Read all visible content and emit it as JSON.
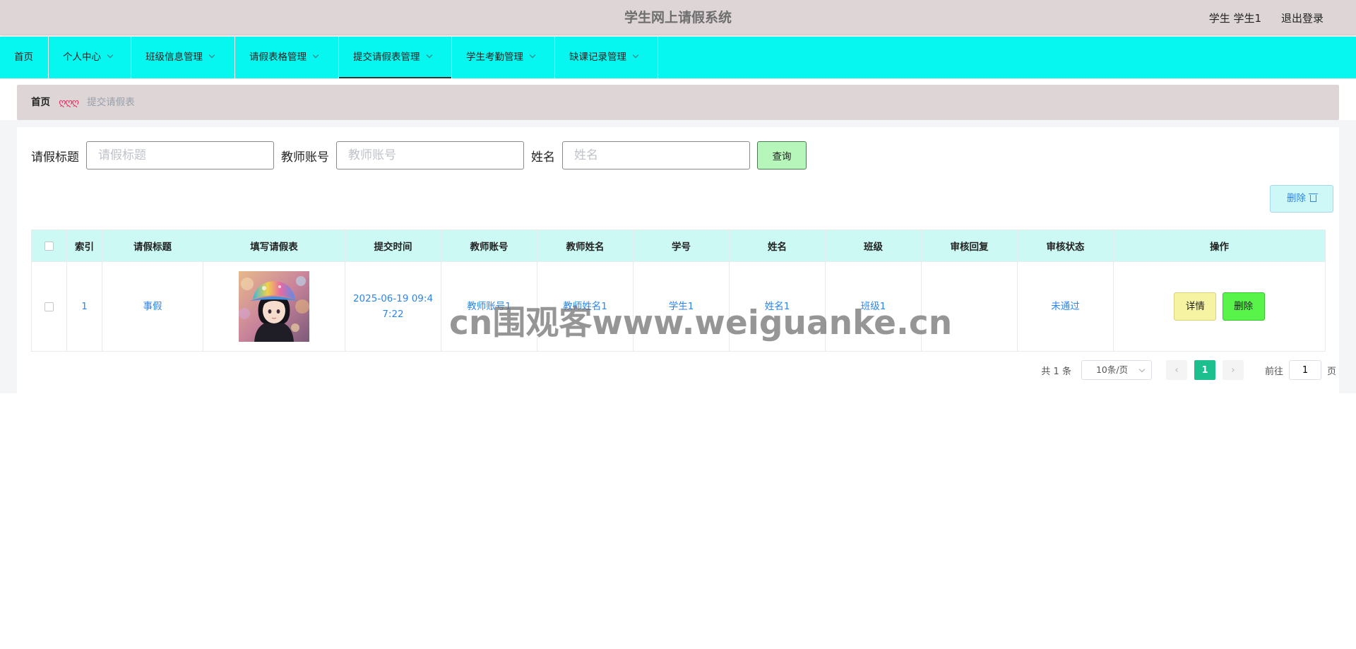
{
  "header": {
    "title": "学生网上请假系统",
    "user": "学生 学生1",
    "logout": "退出登录"
  },
  "nav": {
    "items": [
      {
        "label": "首页"
      },
      {
        "label": "个人中心"
      },
      {
        "label": "班级信息管理"
      },
      {
        "label": "请假表格管理"
      },
      {
        "label": "提交请假表管理"
      },
      {
        "label": "学生考勤管理"
      },
      {
        "label": "缺课记录管理"
      }
    ],
    "active": "提交请假表管理"
  },
  "breadcrumb": {
    "home": "首页",
    "separator": "ღღღ",
    "current": "提交请假表"
  },
  "search": {
    "fields": [
      {
        "label": "请假标题",
        "placeholder": "请假标题",
        "value": ""
      },
      {
        "label": "教师账号",
        "placeholder": "教师账号",
        "value": ""
      },
      {
        "label": "姓名",
        "placeholder": "姓名",
        "value": ""
      }
    ],
    "query_label": "查询"
  },
  "toolbar": {
    "delete_label": "删除"
  },
  "table": {
    "headers": [
      "索引",
      "请假标题",
      "填写请假表",
      "提交时间",
      "教师账号",
      "教师姓名",
      "学号",
      "姓名",
      "班级",
      "审核回复",
      "审核状态",
      "操作"
    ],
    "rows": [
      {
        "index": "1",
        "title": "事假",
        "image_icon": "avatar-image",
        "submit_time": "2025-06-19 09:47:22",
        "teacher_account": "教师账号1",
        "teacher_name": "教师姓名1",
        "student_id": "学生1",
        "name": "姓名1",
        "class": "班级1",
        "reply": "",
        "status": "未通过",
        "detail_label": "详情",
        "delete_label": "删除"
      }
    ]
  },
  "pagination": {
    "total": "共 1 条",
    "page_size": "10条/页",
    "current_page": "1",
    "goto_prefix": "前往",
    "goto_value": "1",
    "goto_suffix": "页"
  },
  "watermark": "cn围观客www.weiguanke.cn",
  "colors": {
    "topbar": "#ded5d6",
    "nav": "#05f7ef",
    "table_header": "#cdf9f4",
    "link": "#2a86f0",
    "query_button": "#b6f6bb",
    "detail_button": "#f6f3a2",
    "delete_button": "#58f44a",
    "page_active": "#1ebf8f"
  }
}
